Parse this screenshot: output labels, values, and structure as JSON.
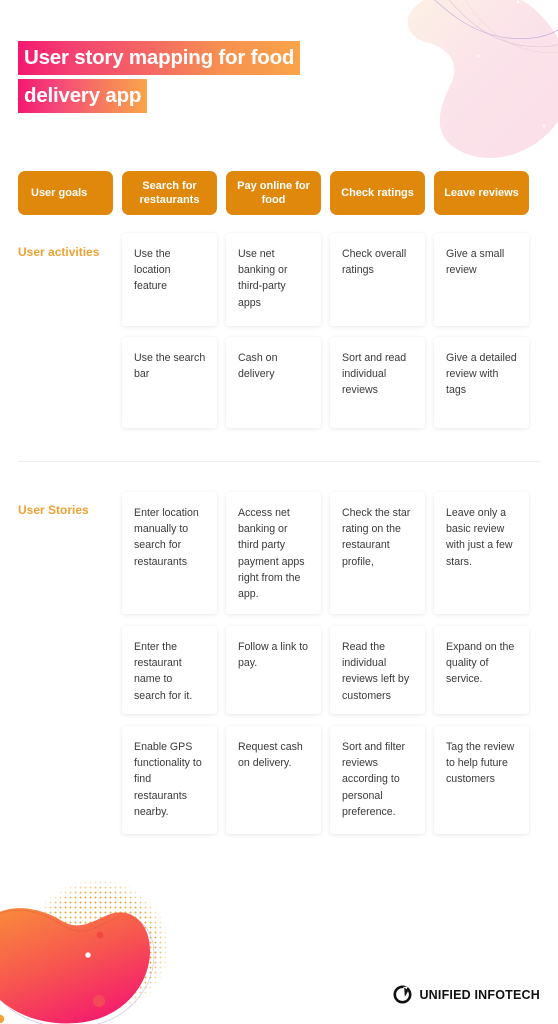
{
  "title": {
    "line1": "User story mapping for food",
    "line2": "delivery app"
  },
  "colors": {
    "goal_tab": "#e0880c",
    "section_label": "#f0a133",
    "title_gradient_start": "#f4186f",
    "title_gradient_end": "#f9a44a",
    "card_text": "#3a3a3c",
    "blob_gradient_start": "#f98a3c",
    "blob_gradient_end": "#f4186f",
    "dots": "#f0a32a"
  },
  "goals": {
    "row_label": "User goals",
    "tabs": [
      {
        "label": "User goals"
      },
      {
        "label": "Search for restaurants"
      },
      {
        "label": "Pay online for food"
      },
      {
        "label": "Check ratings"
      },
      {
        "label": "Leave reviews"
      }
    ]
  },
  "activities": {
    "label": "User activities",
    "columns": [
      [
        "Use the location feature",
        "Use the search bar"
      ],
      [
        "Use net banking or third-party apps",
        "Cash on delivery"
      ],
      [
        "Check overall ratings",
        "Sort and read individual reviews"
      ],
      [
        "Give a small review",
        "Give a detailed review with tags"
      ]
    ]
  },
  "stories": {
    "label": "User Stories",
    "columns": [
      [
        "Enter location manually to search for restaurants",
        "Enter the restaurant name to search for it.",
        "Enable GPS functionality to find restaurants nearby."
      ],
      [
        "Access net banking or third party payment apps right from the app.",
        "Follow a link to pay.",
        "Request cash on delivery."
      ],
      [
        "Check the star rating on the restaurant profile,",
        "Read the individual reviews left by customers",
        "Sort and filter reviews according to personal preference."
      ],
      [
        "Leave only a basic review with just a few stars.",
        "Expand on the quality of service.",
        "Tag the review to help future customers"
      ]
    ]
  },
  "footer": {
    "brand": "UNIFIED INFOTECH"
  }
}
